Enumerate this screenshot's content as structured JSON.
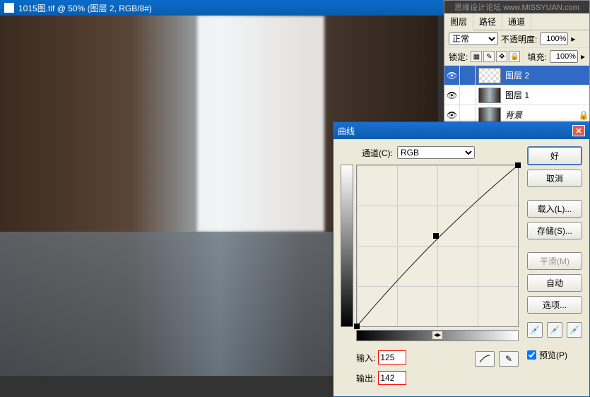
{
  "window": {
    "title": "1015图.tif @ 50% (图层 2, RGB/8#)"
  },
  "watermark": "思缘设计论坛 www.MISSYUAN.com",
  "layers_panel": {
    "tabs": [
      "图层",
      "路径",
      "通道"
    ],
    "blend_mode": "正常",
    "opacity_label": "不透明度:",
    "opacity_value": "100%",
    "lock_label": "锁定:",
    "fill_label": "填充:",
    "fill_value": "100%",
    "items": [
      {
        "name": "图层 2",
        "selected": true,
        "thumb": "checker"
      },
      {
        "name": "图层 1",
        "selected": false,
        "thumb": "img"
      },
      {
        "name": "背景",
        "selected": false,
        "thumb": "img",
        "locked": true
      }
    ]
  },
  "curves": {
    "title": "曲线",
    "channel_label": "通道(C):",
    "channel_value": "RGB",
    "input_label": "输入:",
    "input_value": "125",
    "output_label": "输出:",
    "output_value": "142",
    "buttons": {
      "ok": "好",
      "cancel": "取消",
      "load": "载入(L)...",
      "save": "存储(S)...",
      "smooth": "平滑(M)",
      "auto": "自动",
      "options": "选项..."
    },
    "preview_label": "预览(P)"
  },
  "chart_data": {
    "type": "line",
    "title": "Curves",
    "xlabel": "输入",
    "ylabel": "输出",
    "xlim": [
      0,
      255
    ],
    "ylim": [
      0,
      255
    ],
    "points": [
      {
        "x": 0,
        "y": 0
      },
      {
        "x": 125,
        "y": 142
      },
      {
        "x": 255,
        "y": 255
      }
    ]
  }
}
